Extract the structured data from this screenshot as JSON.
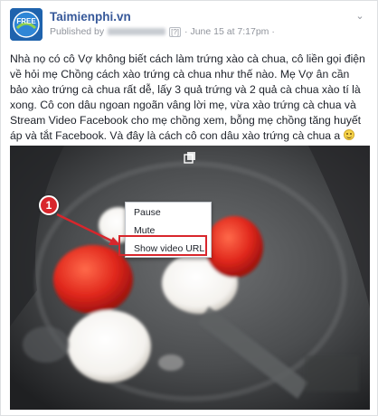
{
  "post": {
    "page_name": "Taimienphi.vn",
    "published_by_label": "Published by",
    "date_text": "· June 15 at 7:17pm ·",
    "privacy_tag": "[?]",
    "text": "Nhà nọ có cô Vợ không biết cách làm trứng xào cà chua, cô liền gọi điện về hỏi mẹ Chồng cách xào trứng cà chua như thế nào. Mẹ Vợ ân cần bảo xào trứng cà chua rất dễ, lấy 3 quả trứng và 2 quả cà chua xào tí là xong. Cô con dâu ngoan ngoãn vâng lời mẹ, vừa xào trứng cà chua và Stream Video Facebook cho mẹ chồng xem, bỗng mẹ chồng tăng huyết áp và tắt Facebook. Và đây là cách cô con dâu xào trứng cà chua a"
  },
  "video": {
    "context_menu": {
      "pause": "Pause",
      "mute": "Mute",
      "show_video_url": "Show video URL"
    },
    "callout_number": "1"
  },
  "icons": {
    "avatar": "free-logo-icon",
    "post_options": "chevron-down-icon",
    "emoji": "smiley-icon",
    "popout": "popout-icon"
  },
  "colors": {
    "link": "#365899",
    "highlight": "#d8262c",
    "meta": "#90949c"
  }
}
